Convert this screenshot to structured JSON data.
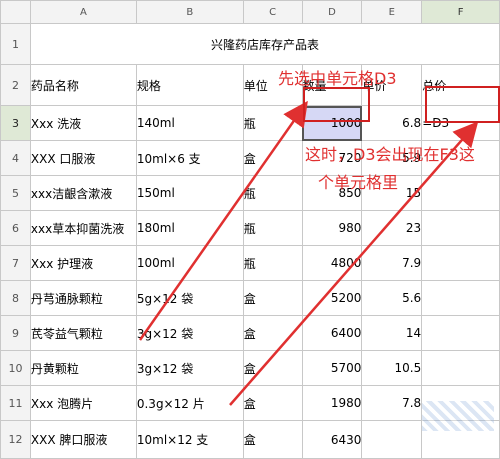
{
  "columns": [
    "A",
    "B",
    "C",
    "D",
    "E",
    "F"
  ],
  "title": "兴隆药店库存产品表",
  "headers": [
    "药品名称",
    "规格",
    "单位",
    "数量",
    "单价",
    "总价"
  ],
  "rows": [
    {
      "num": "3",
      "name": "Xxx 洗液",
      "spec": "140ml",
      "unit": "瓶",
      "qty": "1000",
      "price": "6.8",
      "total": "=D3"
    },
    {
      "num": "4",
      "name": "XXX 口服液",
      "spec": "10ml×6 支",
      "unit": "盒",
      "qty": "720",
      "price": "5.9",
      "total": ""
    },
    {
      "num": "5",
      "name": "xxx洁齦含漱液",
      "spec": "150ml",
      "unit": "瓶",
      "qty": "850",
      "price": "15",
      "total": ""
    },
    {
      "num": "6",
      "name": "xxx草本抑菌洗液",
      "spec": "180ml",
      "unit": "瓶",
      "qty": "980",
      "price": "23",
      "total": ""
    },
    {
      "num": "7",
      "name": "Xxx 护理液",
      "spec": "100ml",
      "unit": "瓶",
      "qty": "4800",
      "price": "7.9",
      "total": ""
    },
    {
      "num": "8",
      "name": "丹芎通脉颗粒",
      "spec": "5g×12 袋",
      "unit": "盒",
      "qty": "5200",
      "price": "5.6",
      "total": ""
    },
    {
      "num": "9",
      "name": "芪苓益气颗粒",
      "spec": "3g×12 袋",
      "unit": "盒",
      "qty": "6400",
      "price": "14",
      "total": ""
    },
    {
      "num": "10",
      "name": "丹黄颗粒",
      "spec": "3g×12 袋",
      "unit": "盒",
      "qty": "5700",
      "price": "10.5",
      "total": ""
    },
    {
      "num": "11",
      "name": "Xxx 泡腾片",
      "spec": "0.3g×12 片",
      "unit": "盒",
      "qty": "1980",
      "price": "7.8",
      "total": ""
    },
    {
      "num": "12",
      "name": "XXX 脾口服液",
      "spec": "10ml×12 支",
      "unit": "盒",
      "qty": "6430",
      "price": "",
      "total": ""
    }
  ],
  "annotations": {
    "first": "先选中单元格D3",
    "second_line1": "这时，D3会出现在F3这",
    "second_line2": "个单元格里"
  },
  "colors": {
    "annotation": "#e03030",
    "selection": "#d6d8f5",
    "active_header": "#dfe9d6"
  }
}
